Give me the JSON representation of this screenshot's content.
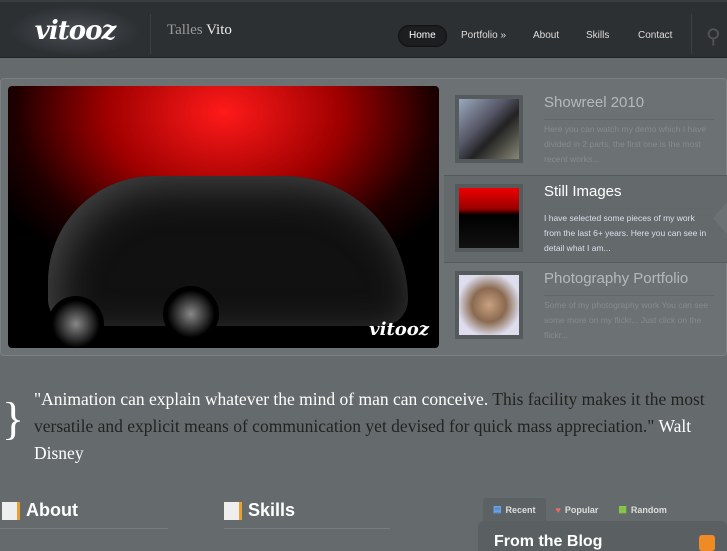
{
  "header": {
    "logo": "vitooz",
    "site_title_first": "Talles",
    "site_title_last": "Vito",
    "nav": [
      {
        "label": "Home"
      },
      {
        "label": "Portfolio »"
      },
      {
        "label": "About"
      },
      {
        "label": "Skills"
      },
      {
        "label": "Contact"
      }
    ]
  },
  "slider": {
    "signature": "vitooz",
    "items": [
      {
        "title": "Showreel 2010",
        "text": "Here you can watch my demo which I have divided in 2 parts, the first one is the most recent works..."
      },
      {
        "title": "Still Images",
        "text": "I have selected some pieces of my work from the last 6+ years. Here you can see in detail what I am..."
      },
      {
        "title": "Photography Portfolio",
        "text": "Some of my photography work You can see some more on my flickr... Just click on the flickr..."
      }
    ]
  },
  "quote": {
    "highlight": "\"Animation can explain whatever the mind of man can conceive.",
    "rest": " This facility makes it the most versatile and explicit means of communication yet devised for quick mass appreciation.\"",
    "author": " Walt Disney"
  },
  "sections": {
    "about": "About",
    "skills": "Skills"
  },
  "tabs": [
    {
      "label": "Recent"
    },
    {
      "label": "Popular"
    },
    {
      "label": "Random"
    }
  ],
  "blog": {
    "title": "From the Blog"
  }
}
